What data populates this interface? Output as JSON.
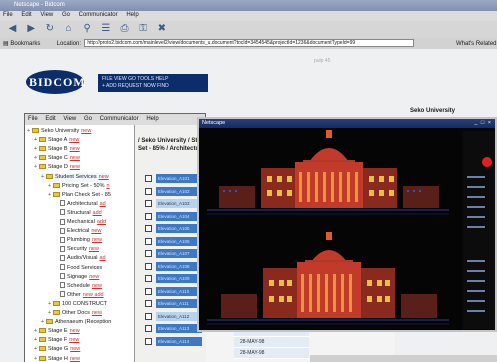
{
  "back_browser": {
    "title": "Netscape - Bidcom",
    "menu": [
      "File",
      "Edit",
      "View",
      "Go",
      "Communicator",
      "Help"
    ],
    "bookmarks_label": "Bookmarks",
    "location_label": "Location:",
    "url": "http://proto2.bidcom.com/mainlevel2/view/documents_u.document?tocId=3454545&projectId=1236&documentTypeId=99",
    "whats_related": "What's Related"
  },
  "brand": {
    "logo_text": "BIDCOM",
    "nav_line1": "FILE  VIEW  GO  TOOLS  HELP",
    "nav_line2": "+ ADD  REQUEST NOW  FIND"
  },
  "page_number": "pulp 45",
  "org_label": "Seko University",
  "front_browser": {
    "menu": [
      "File",
      "Edit",
      "View",
      "Go",
      "Communicator",
      "Help"
    ],
    "doc_header_line1": "/ Seko University / Stage 0",
    "doc_header_line2": "Set - 85% / Architectural"
  },
  "tree": [
    {
      "label": "Seko University",
      "flag": "new",
      "indent": 0,
      "icon": "folder"
    },
    {
      "label": "Stage A",
      "flag": "new",
      "indent": 1,
      "icon": "folder"
    },
    {
      "label": "Stage B",
      "flag": "new",
      "indent": 1,
      "icon": "folder"
    },
    {
      "label": "Stage C",
      "flag": "new",
      "indent": 1,
      "icon": "folder"
    },
    {
      "label": "Stage D",
      "flag": "new",
      "indent": 1,
      "icon": "folder"
    },
    {
      "label": "Student Services",
      "flag": "new",
      "indent": 2,
      "icon": "folder"
    },
    {
      "label": "Pricing Set - 50%",
      "flag": "n",
      "indent": 3,
      "icon": "folder"
    },
    {
      "label": "Plan Check Set - 85",
      "flag": "",
      "indent": 3,
      "icon": "folder"
    },
    {
      "label": "Architectural",
      "flag": "ad",
      "indent": 4,
      "icon": "doc"
    },
    {
      "label": "Structural",
      "flag": "add",
      "indent": 4,
      "icon": "doc"
    },
    {
      "label": "Mechanical",
      "flag": "add",
      "indent": 4,
      "icon": "doc"
    },
    {
      "label": "Electrical",
      "flag": "new",
      "indent": 4,
      "icon": "doc"
    },
    {
      "label": "Plumbing",
      "flag": "new",
      "indent": 4,
      "icon": "doc"
    },
    {
      "label": "Security",
      "flag": "new",
      "indent": 4,
      "icon": "doc"
    },
    {
      "label": "Audio/Visual",
      "flag": "ad",
      "indent": 4,
      "icon": "doc"
    },
    {
      "label": "Food Services",
      "flag": "",
      "indent": 4,
      "icon": "doc"
    },
    {
      "label": "Signage",
      "flag": "new",
      "indent": 4,
      "icon": "doc"
    },
    {
      "label": "Schedule",
      "flag": "new",
      "indent": 4,
      "icon": "doc"
    },
    {
      "label": "Other",
      "flag": "new  add",
      "indent": 4,
      "icon": "doc"
    },
    {
      "label": "100 CONSTRUCT",
      "flag": "",
      "indent": 3,
      "icon": "folder"
    },
    {
      "label": "Other Docs",
      "flag": "new",
      "indent": 3,
      "icon": "folder"
    },
    {
      "label": "Athenaeum (Reception",
      "flag": "",
      "indent": 2,
      "icon": "folder"
    },
    {
      "label": "Stage E",
      "flag": "new",
      "indent": 1,
      "icon": "folder"
    },
    {
      "label": "Stage F",
      "flag": "new",
      "indent": 1,
      "icon": "folder"
    },
    {
      "label": "Stage G",
      "flag": "new",
      "indent": 1,
      "icon": "folder"
    },
    {
      "label": "Stage H",
      "flag": "new",
      "indent": 1,
      "icon": "folder"
    }
  ],
  "grid_rows": [
    {
      "name": "Elevation_A101"
    },
    {
      "name": "Elevation_A102"
    },
    {
      "name": "Elevation_A103"
    },
    {
      "name": "Elevation_A104"
    },
    {
      "name": "Elevation_A105"
    },
    {
      "name": "Elevation_A106"
    },
    {
      "name": "Elevation_A107"
    },
    {
      "name": "Elevation_A108"
    },
    {
      "name": "Elevation_A109"
    },
    {
      "name": "Elevation_A110"
    },
    {
      "name": "Elevation_A111"
    },
    {
      "name": "Elevation_A112"
    },
    {
      "name": "Elevation_A113"
    },
    {
      "name": "Elevation_A114"
    }
  ],
  "date_cells": [
    "28-MAY-98",
    "28-MAY-98",
    "28-MAY-98"
  ],
  "viewer": {
    "title": "Netscape",
    "win_buttons": "_ □ ×"
  }
}
